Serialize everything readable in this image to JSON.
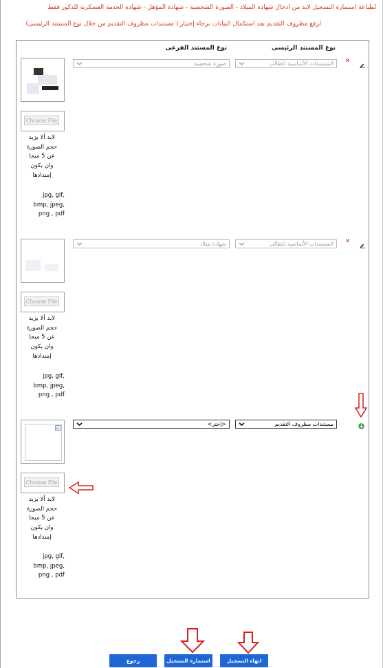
{
  "notices": {
    "line1": "لطباعة استمارة التسجيل لابد من ادخال شهادة الميلاد - الصورة الشخصية - شهادة المؤهل - شهادة الخدمة العسكرية للذكور فقط",
    "line2": "لرفع مظروف التقديم بعد استكمال البيانات برجاء إختيار ( مستندات مظروف التقديم من خلال نوع المستند الرئيسى)"
  },
  "table": {
    "col_main": "نوع المستند الرئيسى",
    "col_sub": "نوع المستند الفرعى"
  },
  "rows": [
    {
      "main_value": "المستندات الأساسية للطالب",
      "sub_value": "صورة شخصية",
      "file_button": "Choose File",
      "note": "لابد ألا يزيد\nحجم الصورة\nعن 5 ميجا\nوان يكون\nإمتدادها",
      "extensions": "jpg, gif,\nbmp, jpeg,\npng , pdf"
    },
    {
      "main_value": "المستندات الأساسية للطالب",
      "sub_value": "شهادة ميلاد",
      "file_button": "Choose File",
      "note": "لابد ألا يزيد\nحجم الصورة\nعن 5 ميجا\nوان يكون\nإمتدادها",
      "extensions": "jpg, gif,\nbmp, jpeg,\npng , pdf"
    },
    {
      "main_value": "مستندات مظروف التقديم",
      "sub_value": "<إختر>",
      "file_button": "Choose File",
      "note": "لابد ألا يزيد\nحجم الصورة\nعن 5 ميجا\nوان يكون\nإمتدادها",
      "extensions": "jpg, gif,\nbmp, jpeg,\npng , pdf"
    }
  ],
  "icons": {
    "delete": "delete-x-icon",
    "edit": "pencil-icon",
    "add": "add-plus-icon"
  },
  "buttons": {
    "finish": "انهاء التسجيل",
    "form": "استمارة التسجيل",
    "back": "رجوع"
  },
  "colors": {
    "notice": "#d9381e",
    "button": "#1f66d6",
    "arrow": "#d52020"
  }
}
